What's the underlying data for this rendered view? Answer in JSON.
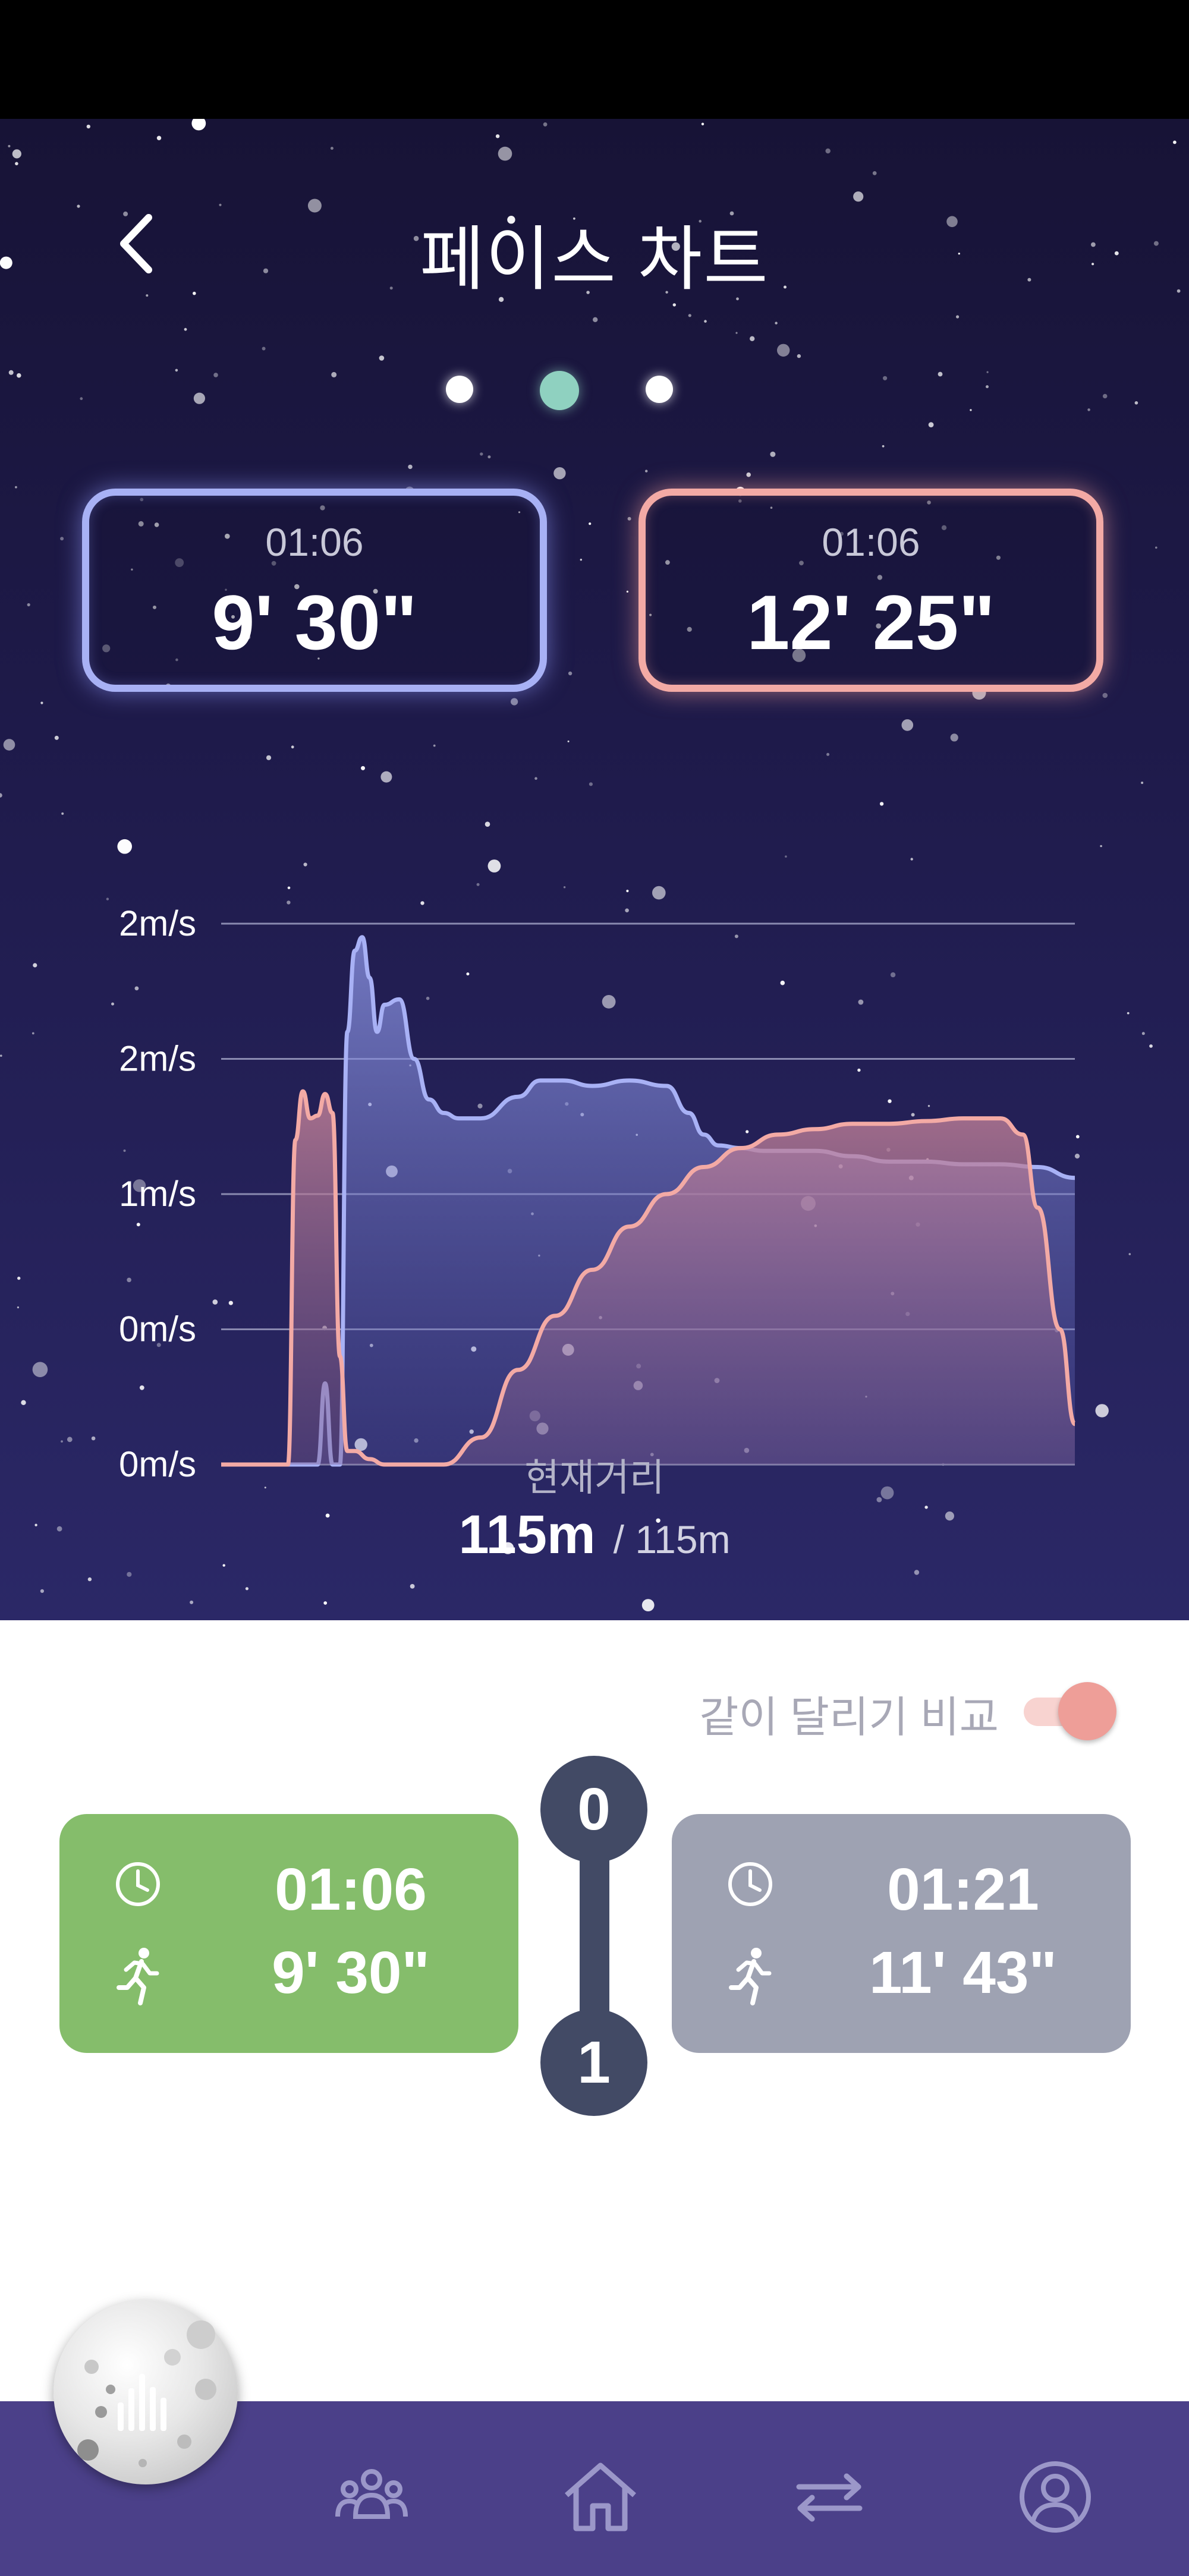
{
  "header": {
    "title": "페이스 차트",
    "back_icon": "chevron-left-icon"
  },
  "page_indicator": {
    "count": 3,
    "active_index": 1,
    "active_color": "#8fd1c0"
  },
  "pace_cards": [
    {
      "time": "01:06",
      "pace": "9' 30\"",
      "color": "#a8b1f5"
    },
    {
      "time": "01:06",
      "pace": "12' 25\"",
      "color": "#f3aaa5"
    }
  ],
  "chart_data": {
    "type": "area",
    "y_tick_labels": [
      "2m/s",
      "2m/s",
      "1m/s",
      "0m/s",
      "0m/s"
    ],
    "ylim": [
      0,
      2
    ],
    "grid": true,
    "x_unit": "m",
    "xlim": [
      0,
      115
    ],
    "series": [
      {
        "color": "#a8b1f5",
        "x": [
          0,
          13,
          14,
          15,
          16,
          17,
          18,
          19,
          20,
          21,
          22,
          24,
          26,
          28,
          30,
          32,
          35,
          40,
          43,
          46,
          50,
          55,
          60,
          63,
          65,
          67,
          70,
          73,
          80,
          85,
          90,
          95,
          100,
          105,
          110,
          115
        ],
        "y": [
          0,
          0,
          0.3,
          0,
          0,
          1.6,
          1.9,
          1.95,
          1.8,
          1.6,
          1.7,
          1.72,
          1.5,
          1.35,
          1.3,
          1.28,
          1.28,
          1.36,
          1.42,
          1.42,
          1.4,
          1.42,
          1.4,
          1.3,
          1.22,
          1.18,
          1.17,
          1.16,
          1.16,
          1.14,
          1.12,
          1.12,
          1.11,
          1.11,
          1.1,
          1.06
        ]
      },
      {
        "color": "#f3aaa5",
        "x": [
          0,
          8,
          9,
          10,
          11,
          12,
          13,
          14,
          15,
          16,
          17,
          18,
          20,
          22,
          25,
          30,
          35,
          40,
          45,
          50,
          55,
          60,
          65,
          70,
          75,
          80,
          85,
          90,
          95,
          100,
          105,
          108,
          110,
          113,
          115
        ],
        "y": [
          0,
          0,
          0,
          1.2,
          1.38,
          1.28,
          1.29,
          1.37,
          1.3,
          0.4,
          0.05,
          0.05,
          0.02,
          0,
          0,
          0,
          0.1,
          0.35,
          0.55,
          0.72,
          0.88,
          1.0,
          1.1,
          1.17,
          1.22,
          1.24,
          1.26,
          1.26,
          1.27,
          1.28,
          1.28,
          1.22,
          0.95,
          0.5,
          0.15
        ]
      }
    ]
  },
  "distance": {
    "label": "현재거리",
    "current": "115m",
    "total": "/ 115m"
  },
  "compare": {
    "label": "같이 달리기 비교",
    "toggle_on": true,
    "toggle_color": "#ee9e98"
  },
  "cards": [
    {
      "time": "01:06",
      "pace": "9' 30\"",
      "color": "#85bd6b"
    },
    {
      "time": "01:21",
      "pace": "11' 43\"",
      "color": "#9ea2b2"
    }
  ],
  "nodes": {
    "top": "0",
    "bottom": "1"
  },
  "nav": {
    "items": [
      {
        "icon": "group-icon"
      },
      {
        "icon": "home-icon"
      },
      {
        "icon": "swap-arrows-icon"
      },
      {
        "icon": "profile-icon"
      }
    ],
    "fab_icon": "moon-bar-chart-icon"
  }
}
